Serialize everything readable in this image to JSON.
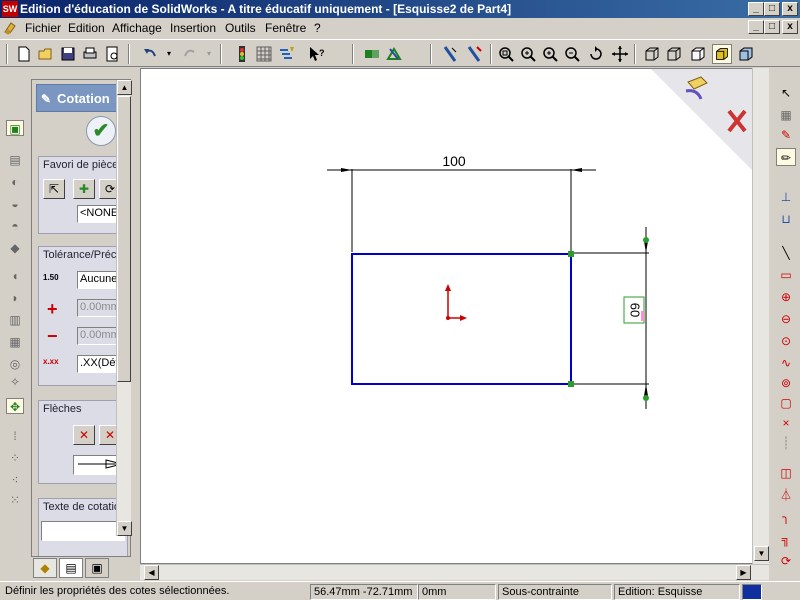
{
  "window": {
    "app_icon": "SW",
    "title": "Edition d'éducation de SolidWorks - A titre éducatif uniquement - [Esquisse2 de Part4]",
    "buttons": [
      "_",
      "□",
      "x"
    ]
  },
  "menu": {
    "items": [
      "Fichier",
      "Edition",
      "Affichage",
      "Insertion",
      "Outils",
      "Fenêtre",
      "?"
    ],
    "doc_buttons": [
      "_",
      "□",
      "x"
    ]
  },
  "toolbar": {
    "icons": [
      "new-icon",
      "open-icon",
      "save-icon",
      "print-icon",
      "print-preview-icon",
      "undo-icon",
      "redo-icon",
      "select-icon",
      "grid-icon",
      "rebuild-icon",
      "help-icon",
      "options-icon",
      "sketch-icon",
      "measure-icon",
      "zoom-fit-icon",
      "zoom-window-icon",
      "zoom-in-icon",
      "zoom-out-icon",
      "rotate-icon",
      "pan-icon",
      "wireframe-icon",
      "hidden-lines-icon",
      "shaded-icon"
    ]
  },
  "property_manager": {
    "title": "Cotation",
    "ok_icon": "check-icon",
    "favorites": {
      "title": "Favori de pièce",
      "field": "<NONE>"
    },
    "tolerance": {
      "title": "Tolérance/Précision",
      "type_label": "1.50",
      "type_value": "Aucune",
      "plus_value": "0.00mm",
      "minus_value": "0.00mm",
      "precision_value": ".XX(Défaut)"
    },
    "arrows": {
      "title": "Flèches"
    },
    "dim_text": {
      "title": "Texte de cotation"
    },
    "tabs": [
      "feature-manager-tab",
      "property-manager-tab",
      "configuration-tab"
    ]
  },
  "sketch": {
    "dim_horizontal": "100",
    "dim_vertical": "60",
    "colors": {
      "rectangle": "#0000cc",
      "selected_point": "#2a9d2a",
      "origin": "#cc0000",
      "confirm": "#cc3333"
    }
  },
  "status": {
    "message": "Définir les propriétés des cotes sélectionnées.",
    "coords": "56.47mm -72.71mm",
    "z": "0mm",
    "constraint": "Sous-contrainte",
    "edit_mode": "Edition: Esquisse"
  }
}
